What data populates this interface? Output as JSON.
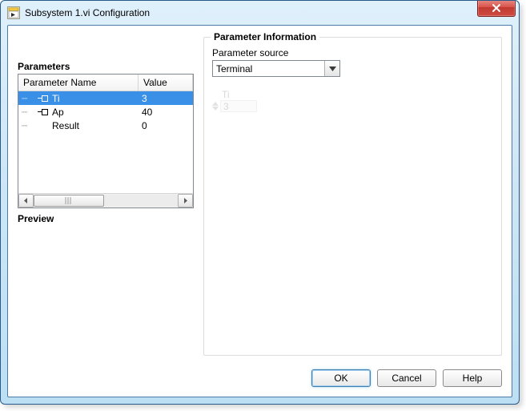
{
  "window": {
    "title": "Subsystem 1.vi Configuration"
  },
  "left": {
    "section_title": "Parameters",
    "columns": {
      "name": "Parameter Name",
      "value": "Value"
    },
    "rows": [
      {
        "name": "Ti",
        "value": "3",
        "has_terminal": true,
        "selected": true
      },
      {
        "name": "Ap",
        "value": "40",
        "has_terminal": true,
        "selected": false
      },
      {
        "name": "Result",
        "value": "0",
        "has_terminal": false,
        "selected": false
      }
    ],
    "preview_title": "Preview"
  },
  "right": {
    "group_title": "Parameter Information",
    "source_label": "Parameter source",
    "source_value": "Terminal",
    "ghost": {
      "name": "Ti",
      "value": "3"
    }
  },
  "buttons": {
    "ok": "OK",
    "cancel": "Cancel",
    "help": "Help"
  }
}
